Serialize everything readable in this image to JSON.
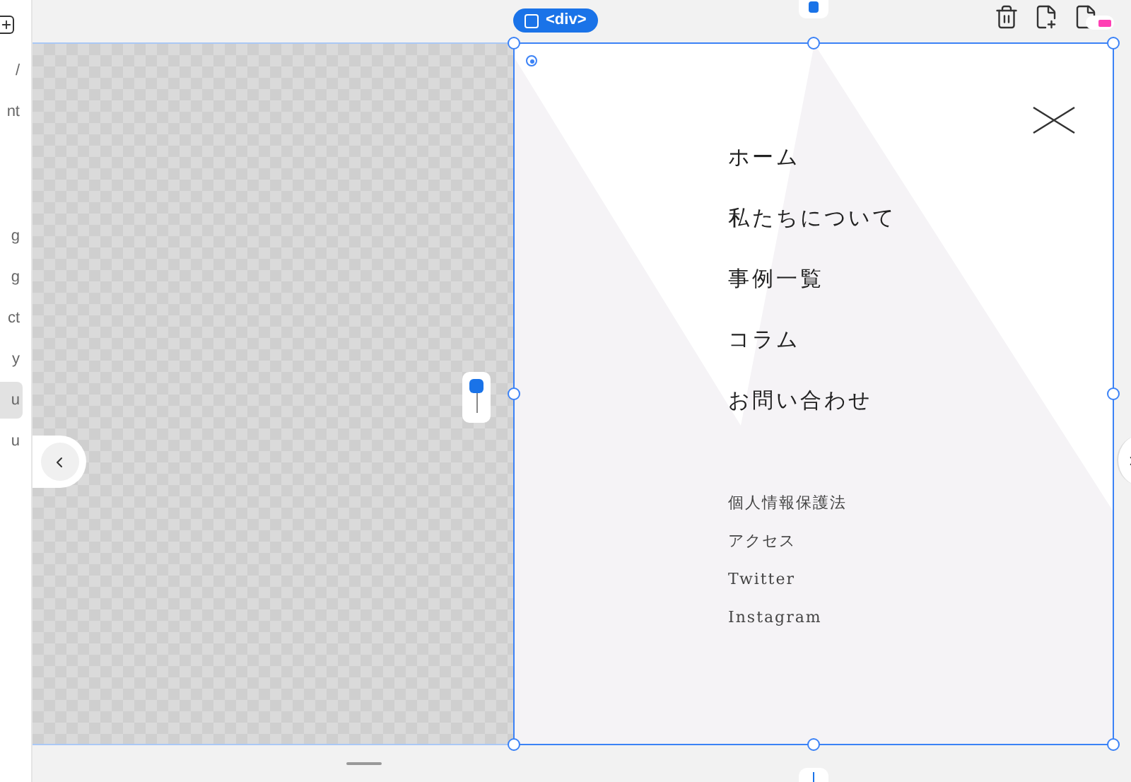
{
  "sidebar": {
    "items": [
      {
        "label": "/",
        "selected": false
      },
      {
        "label": "nt",
        "selected": false
      },
      {
        "label": "g",
        "selected": false
      },
      {
        "label": "g",
        "selected": false
      },
      {
        "label": "ct",
        "selected": false
      },
      {
        "label": "y",
        "selected": false
      },
      {
        "label": "u",
        "selected": true
      },
      {
        "label": "u",
        "selected": false
      }
    ]
  },
  "element_badge": {
    "label": "<div>"
  },
  "menu": {
    "primary": [
      "ホーム",
      "私たちについて",
      "事例一覧",
      "コラム",
      "お問い合わせ"
    ],
    "secondary": [
      "個人情報保護法",
      "アクセス",
      "Twitter",
      "Instagram"
    ]
  }
}
